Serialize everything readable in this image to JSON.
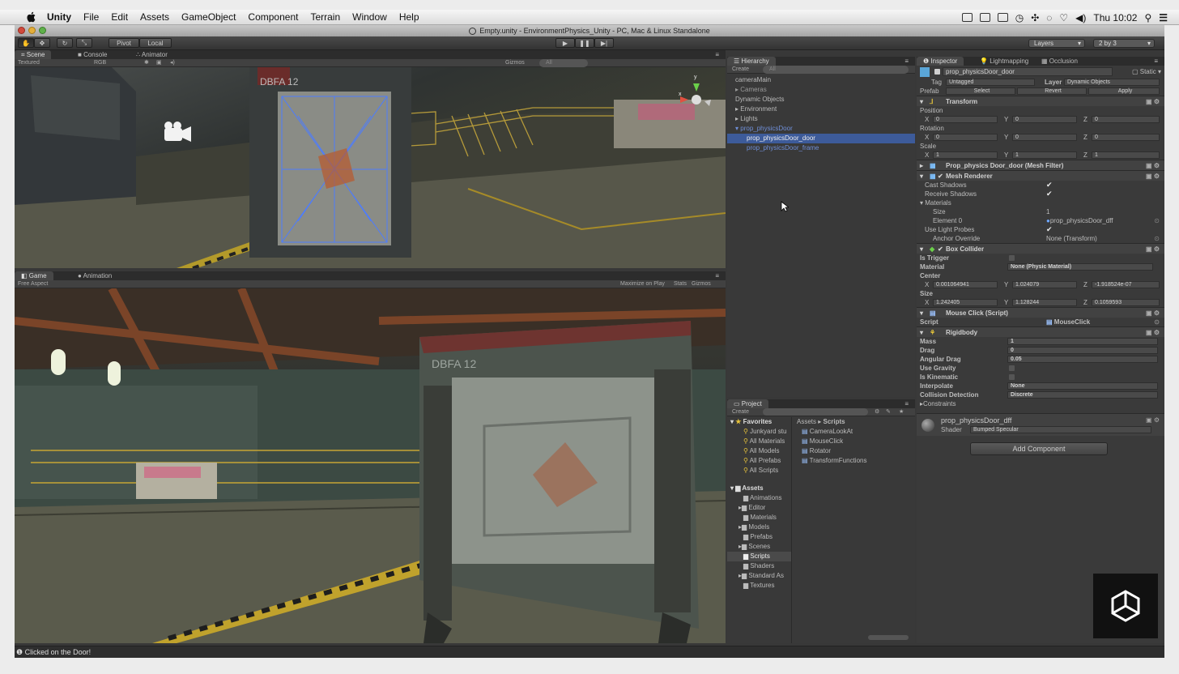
{
  "menubar": {
    "app": "Unity",
    "items": [
      "File",
      "Edit",
      "Assets",
      "GameObject",
      "Component",
      "Terrain",
      "Window",
      "Help"
    ],
    "clock": "Thu 10:02"
  },
  "window": {
    "title": "Empty.unity - EnvironmentPhysics_Unity - PC, Mac & Linux Standalone"
  },
  "toolbar": {
    "pivot": "Pivot",
    "local": "Local",
    "layers": "Layers",
    "layout": "2 by 3"
  },
  "scene": {
    "tabs": [
      "Scene",
      "Console",
      "Animator"
    ],
    "render_mode": "Textured",
    "color_mode": "RGB",
    "gizmos": "Gizmos",
    "search": "All",
    "sign_text": "DBFA 12"
  },
  "game": {
    "tabs": [
      "Game",
      "Animation"
    ],
    "aspect": "Free Aspect",
    "maximize": "Maximize on Play",
    "stats": "Stats",
    "gizmos": "Gizmos",
    "sign_text": "DBFA 12"
  },
  "hierarchy": {
    "tab": "Hierarchy",
    "create": "Create",
    "search": "All",
    "items": [
      {
        "label": "cameraMain",
        "style": "normal",
        "indent": 0
      },
      {
        "label": "Cameras",
        "style": "dim",
        "indent": 0
      },
      {
        "label": "Dynamic Objects",
        "style": "normal",
        "indent": 0
      },
      {
        "label": "Environment",
        "style": "normal",
        "indent": 0
      },
      {
        "label": "Lights",
        "style": "normal",
        "indent": 0
      },
      {
        "label": "prop_physicsDoor",
        "style": "blue",
        "indent": 0
      },
      {
        "label": "prop_physicsDoor_door",
        "style": "selected",
        "indent": 1
      },
      {
        "label": "prop_physicsDoor_frame",
        "style": "blue",
        "indent": 1
      }
    ]
  },
  "project": {
    "tab": "Project",
    "create": "Create",
    "favorites_label": "Favorites",
    "favorites": [
      "Junkyard stu",
      "All Materials",
      "All Models",
      "All Prefabs",
      "All Scripts"
    ],
    "assets_label": "Assets",
    "folders": [
      "Animations",
      "Editor",
      "Materials",
      "Models",
      "Prefabs",
      "Scenes",
      "Scripts",
      "Shaders",
      "Standard As",
      "Textures"
    ],
    "breadcrumb_root": "Assets",
    "breadcrumb_leaf": "Scripts",
    "scripts": [
      "CameraLookAt",
      "MouseClick",
      "Rotator",
      "TransformFunctions"
    ]
  },
  "inspector": {
    "tabs": [
      "Inspector",
      "Lightmapping",
      "Occlusion"
    ],
    "object_name": "prop_physicsDoor_door",
    "static_label": "Static",
    "tag_label": "Tag",
    "tag_value": "Untagged",
    "layer_label": "Layer",
    "layer_value": "Dynamic Objects",
    "prefab_label": "Prefab",
    "prefab_select": "Select",
    "prefab_revert": "Revert",
    "prefab_apply": "Apply",
    "transform": {
      "title": "Transform",
      "position_label": "Position",
      "rotation_label": "Rotation",
      "scale_label": "Scale",
      "position": {
        "x": "0",
        "y": "0",
        "z": "0"
      },
      "rotation": {
        "x": "0",
        "y": "0",
        "z": "0"
      },
      "scale": {
        "x": "1",
        "y": "1",
        "z": "1"
      }
    },
    "mesh_filter_title": "Prop_physics Door_door (Mesh Filter)",
    "mesh_renderer": {
      "title": "Mesh Renderer",
      "cast_shadows": "Cast Shadows",
      "receive_shadows": "Receive Shadows",
      "materials": "Materials",
      "size_label": "Size",
      "size_value": "1",
      "element0_label": "Element 0",
      "element0_value": "prop_physicsDoor_dff",
      "light_probes": "Use Light Probes",
      "anchor_label": "Anchor Override",
      "anchor_value": "None (Transform)"
    },
    "box_collider": {
      "title": "Box Collider",
      "is_trigger": "Is Trigger",
      "material_label": "Material",
      "material_value": "None (Physic Material)",
      "center_label": "Center",
      "center": {
        "x": "0.001064941",
        "y": "1.024079",
        "z": "-1.918524e-07"
      },
      "size_label": "Size",
      "size": {
        "x": "1.242405",
        "y": "1.128244",
        "z": "0.1059593"
      }
    },
    "mouse_click": {
      "title": "Mouse Click (Script)",
      "script_label": "Script",
      "script_value": "MouseClick"
    },
    "rigidbody": {
      "title": "Rigidbody",
      "mass_label": "Mass",
      "mass": "1",
      "drag_label": "Drag",
      "drag": "0",
      "angular_label": "Angular Drag",
      "angular": "0.05",
      "gravity_label": "Use Gravity",
      "kinematic_label": "Is Kinematic",
      "interpolate_label": "Interpolate",
      "interpolate": "None",
      "collision_label": "Collision Detection",
      "collision": "Discrete",
      "constraints_label": "Constraints"
    },
    "material": {
      "name": "prop_physicsDoor_dff",
      "shader_label": "Shader",
      "shader_value": "Bumped Specular"
    },
    "add_component": "Add Component"
  },
  "status": {
    "message": "Clicked on the Door!"
  },
  "colors": {
    "selection": "#3d5b9a",
    "link_blue": "#6f8fd8",
    "panel_bg": "#3b3b3b"
  }
}
